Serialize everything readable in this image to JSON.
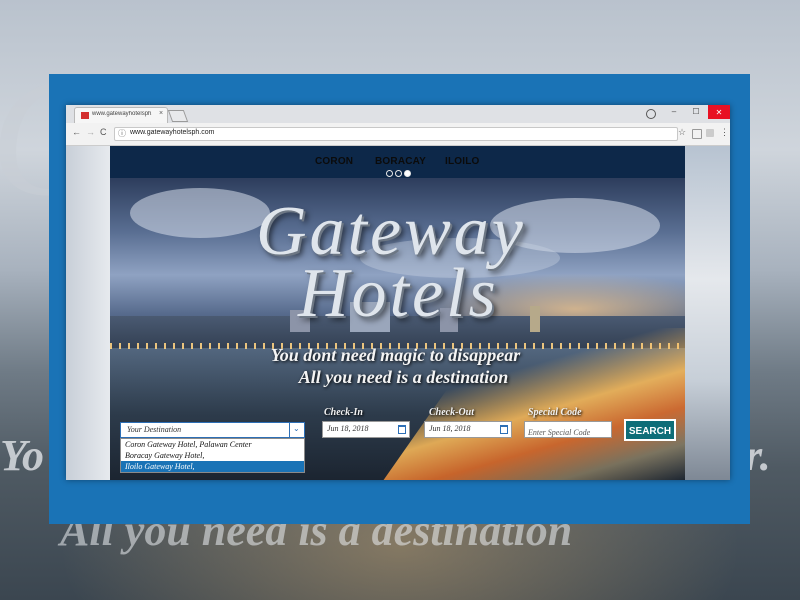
{
  "background": {
    "big_letter": "G",
    "line1_left": "Yo",
    "line1_right": "r.",
    "line2": "All you need is a destination"
  },
  "browser": {
    "tab_title": "www.gatewayhotelsph.co",
    "tab_close": "×",
    "url": "www.gatewayhotelsph.com",
    "controls": {
      "minimize": "–",
      "maximize": "☐",
      "close": "✕"
    },
    "nav": {
      "back": "←",
      "forward": "→",
      "reload": "C"
    },
    "star": "☆",
    "menu": "⋮"
  },
  "site": {
    "nav": [
      "CORON",
      "BORACAY",
      "ILOILO"
    ],
    "carousel": {
      "dots": 3,
      "active": 2
    },
    "title_line1": "Gateway",
    "title_line2": "Hotels",
    "tagline1": "You dont need magic to disappear",
    "tagline2": "All you need is a destination",
    "destination": {
      "placeholder": "Your Destination",
      "arrow": "⌄",
      "options": [
        "Coron Gateway Hotel, Palawan Center",
        "Boracay Gateway Hotel,",
        "Iloilo Gateway Hotel,"
      ],
      "selected_index": 2
    },
    "checkin": {
      "label": "Check-In",
      "value": "Jun 18, 2018"
    },
    "checkout": {
      "label": "Check-Out",
      "value": "Jun 18, 2018"
    },
    "special_code": {
      "label": "Special Code",
      "placeholder": "Enter Special Code"
    },
    "search_label": "SEARCH"
  }
}
